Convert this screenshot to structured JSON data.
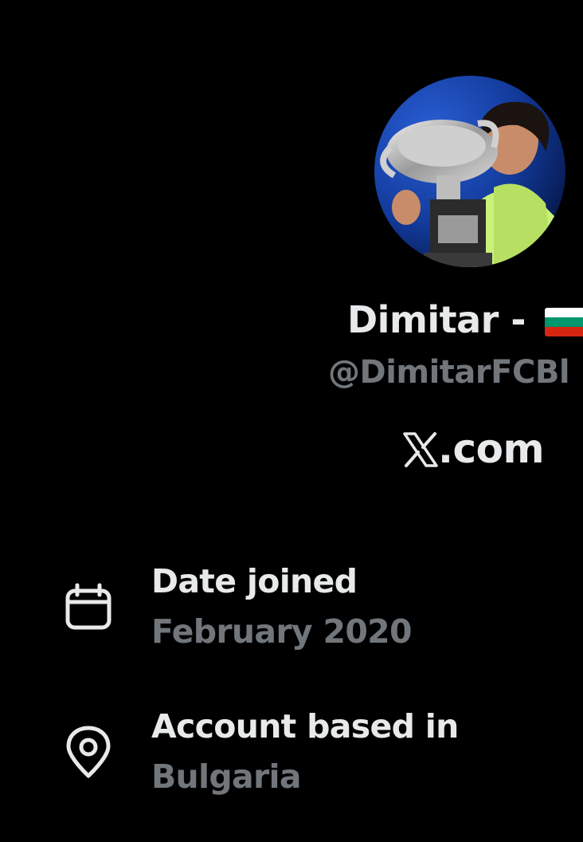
{
  "profile": {
    "display_name": "Dimitar - ",
    "flag_icon": "bulgaria-flag-icon",
    "handle": "@DimitarFCBl",
    "website": ".com",
    "website_icon": "x-logo-icon",
    "avatar_icon": "profile-avatar-image"
  },
  "about": {
    "date_joined": {
      "icon": "calendar-icon",
      "title": "Date joined",
      "value": "February 2020"
    },
    "location": {
      "icon": "location-pin-icon",
      "title": "Account based in",
      "value": "Bulgaria"
    }
  },
  "colors": {
    "background": "#000000",
    "primary_text": "#e7e9ea",
    "secondary_text": "#71767b"
  }
}
